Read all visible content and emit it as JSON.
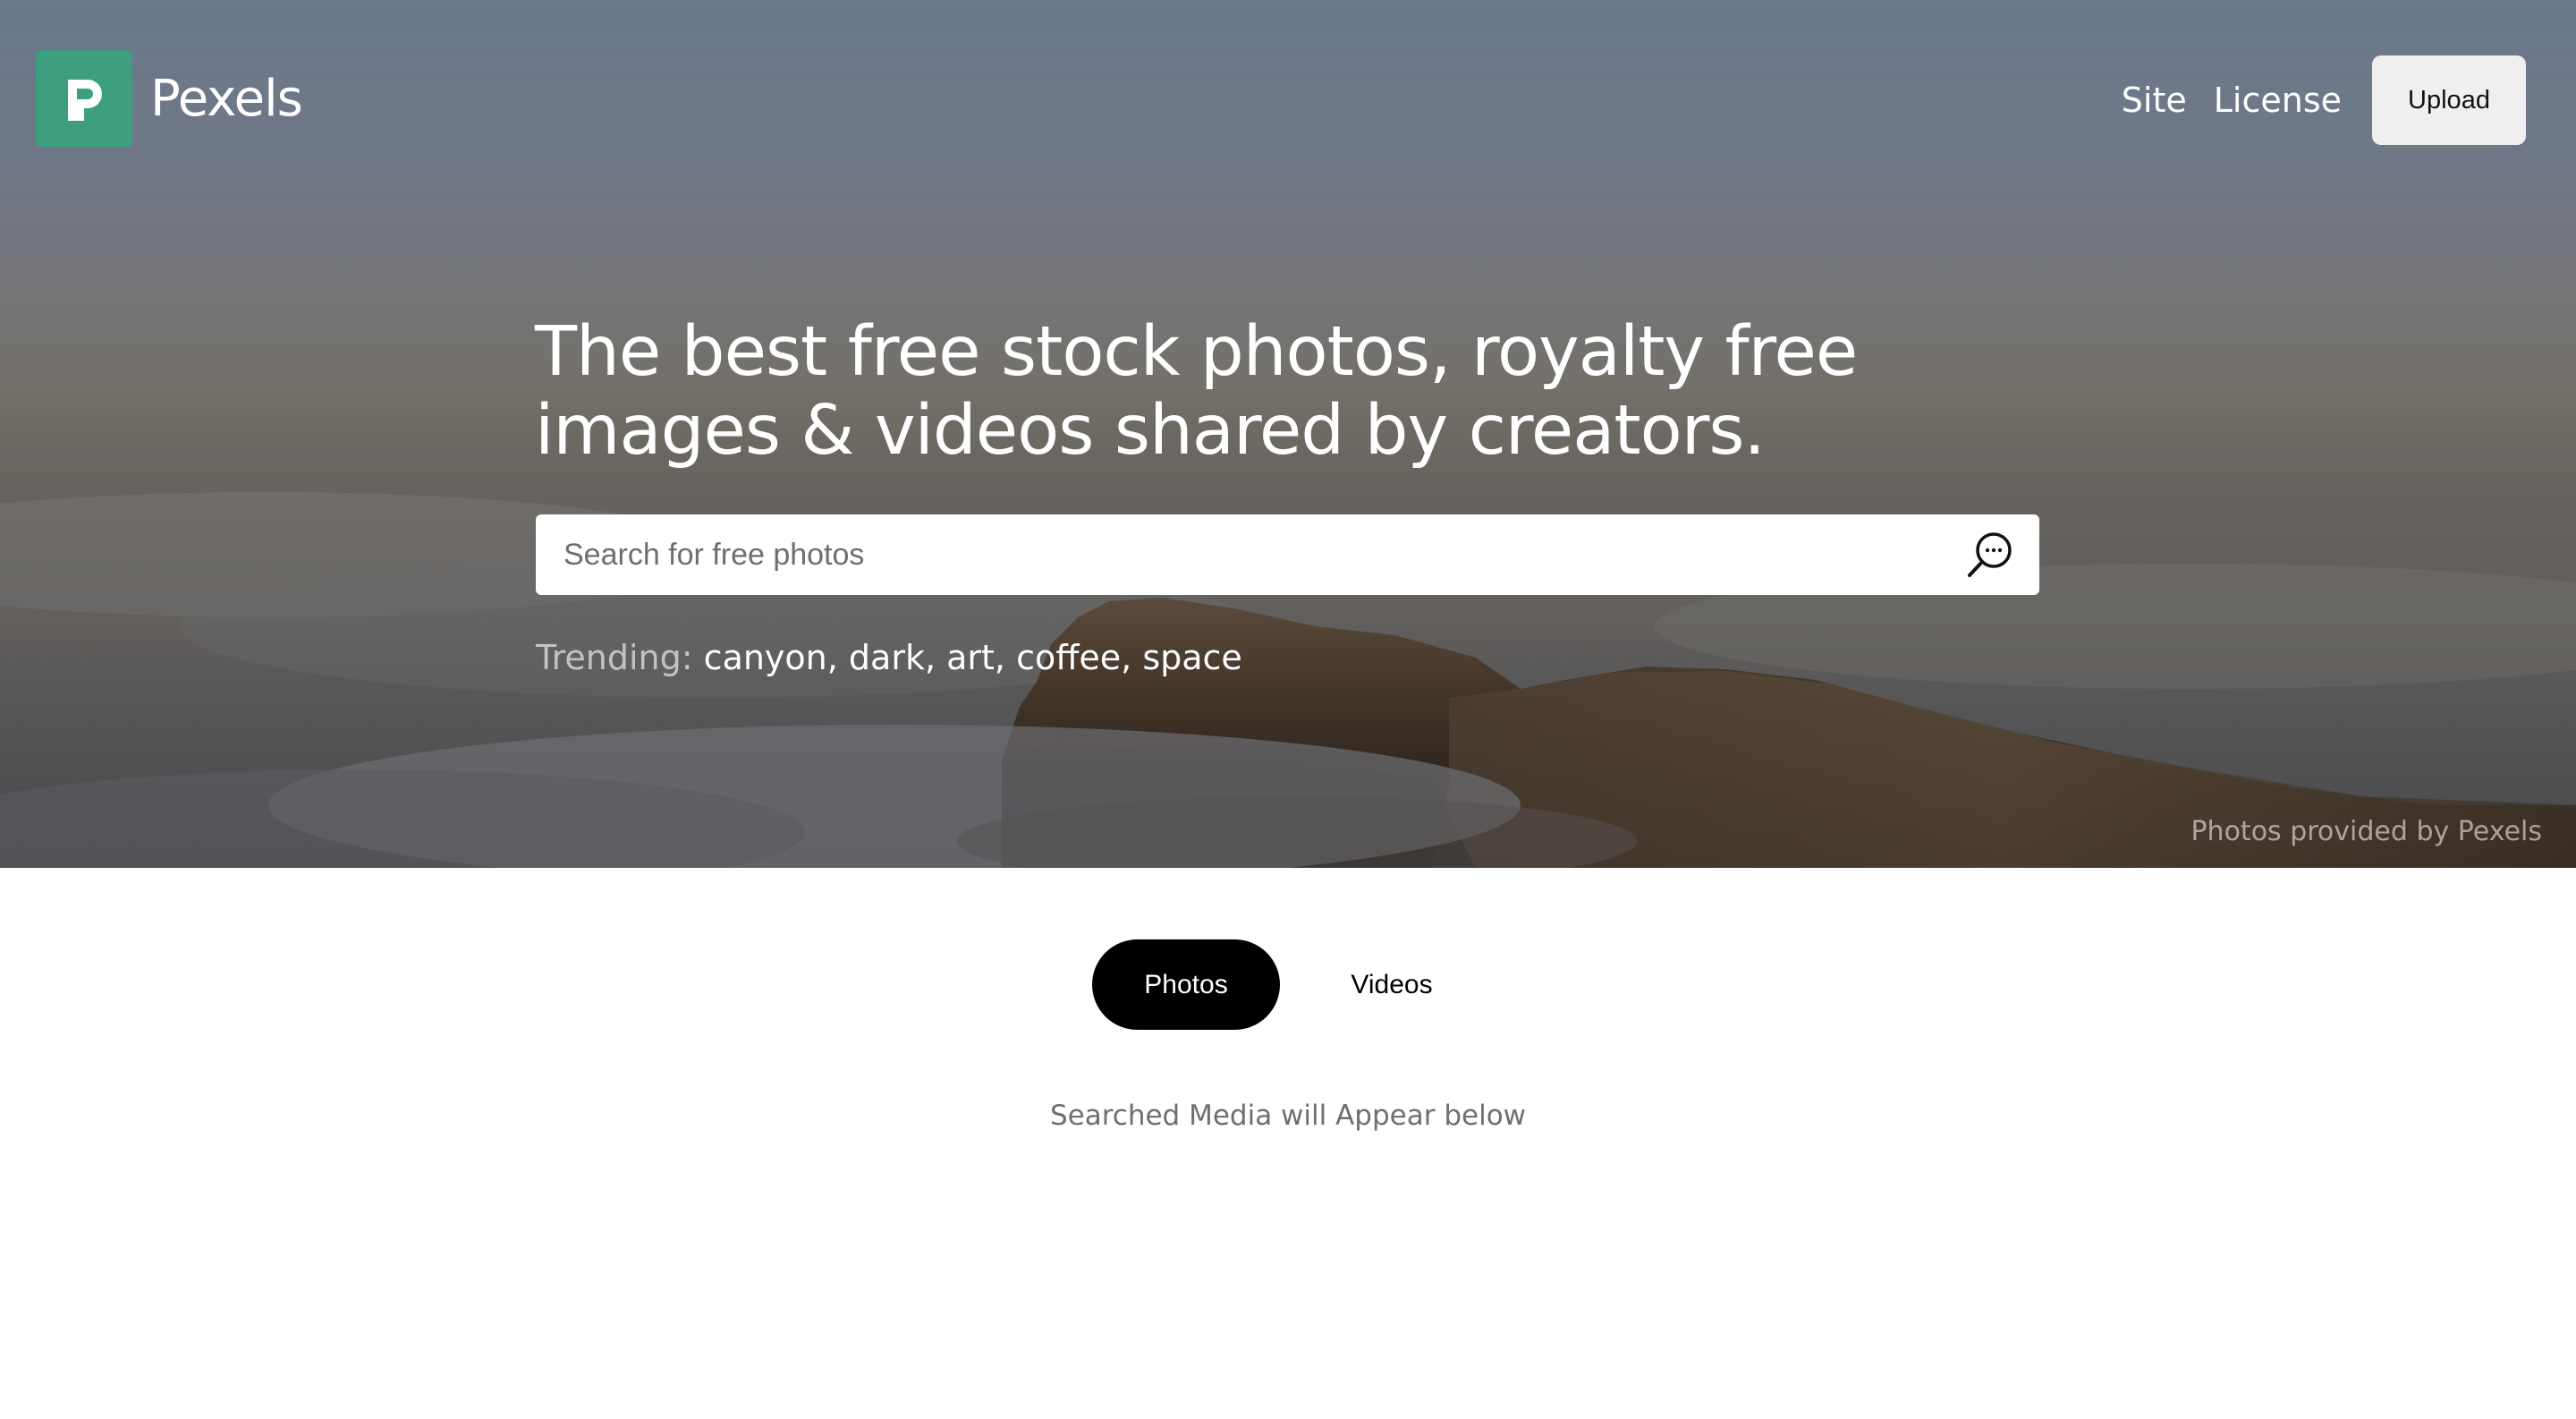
{
  "header": {
    "logo_icon": "pexels-logo-icon",
    "brand": "Pexels",
    "nav": [
      {
        "label": "Site"
      },
      {
        "label": "License"
      }
    ],
    "upload_label": "Upload"
  },
  "hero": {
    "headline": "The best free stock photos, royalty free images & videos shared by creators.",
    "search": {
      "placeholder": "Search for free photos",
      "value": "",
      "icon": "search-icon"
    },
    "trending": {
      "label": "Trending:",
      "terms": "canyon, dark, art, coffee, space"
    },
    "credit": "Photos provided by Pexels",
    "background": "canyon above clouds photo"
  },
  "media_tabs": {
    "items": [
      {
        "label": "Photos",
        "active": true
      },
      {
        "label": "Videos",
        "active": false
      }
    ]
  },
  "results": {
    "hint": "Searched Media will Appear below"
  },
  "colors": {
    "brand": "#3d9f80",
    "active_tab": "#000000"
  }
}
